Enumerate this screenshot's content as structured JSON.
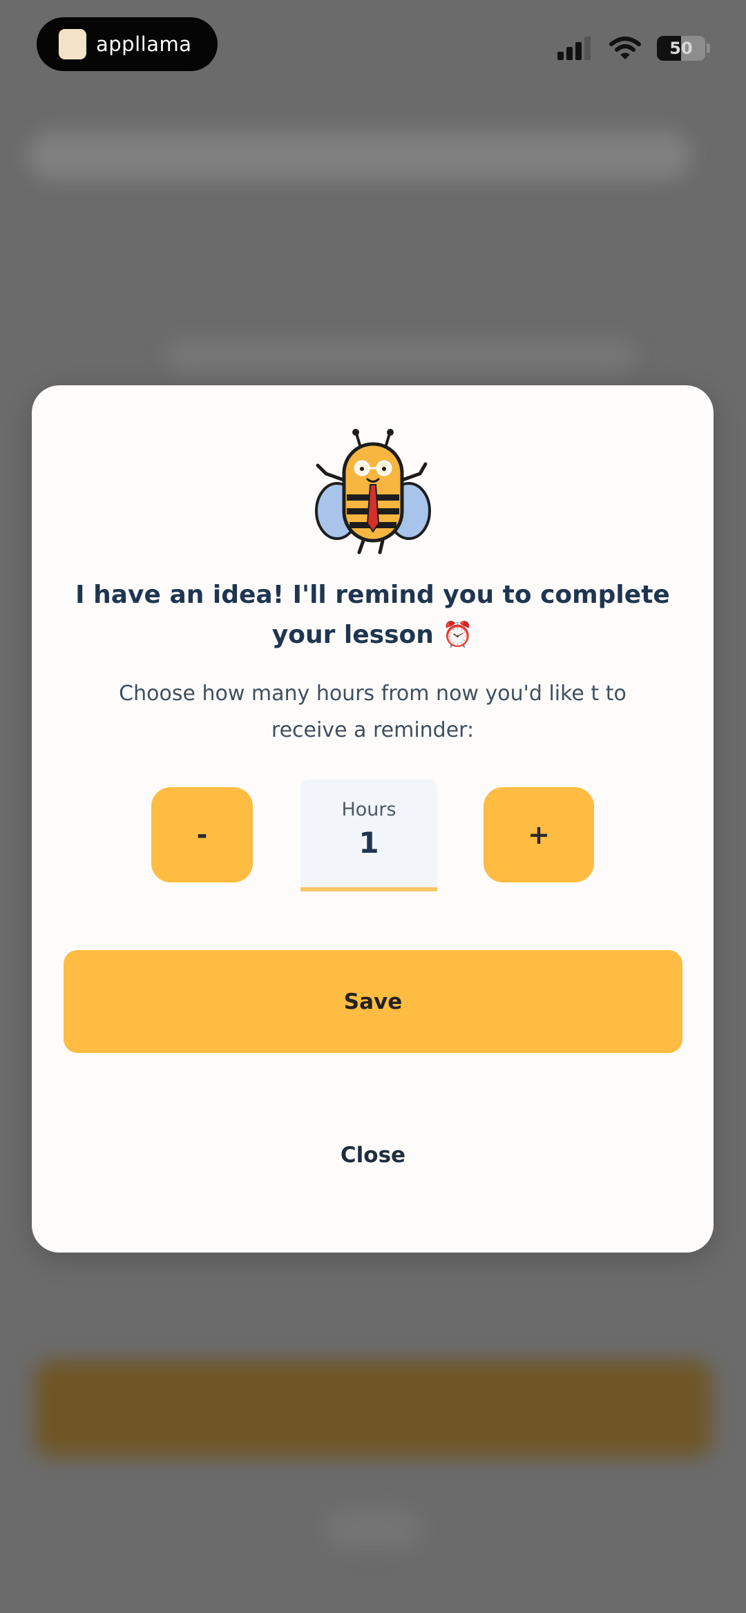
{
  "status_bar": {
    "brand_name": "appllama",
    "battery_level": "50",
    "battery_fraction": 0.5
  },
  "modal": {
    "title": "I have an idea! I'll remind you to complete your lesson ⏰",
    "subtitle": "Choose how many hours from now you'd like t to receive a reminder:",
    "decrement_label": "-",
    "increment_label": "+",
    "hours_label": "Hours",
    "hours_value": "1",
    "save_label": "Save",
    "close_label": "Close"
  },
  "colors": {
    "accent": "#ffbc42",
    "title_text": "#1f3550",
    "overlay": "#6b6b6b"
  }
}
